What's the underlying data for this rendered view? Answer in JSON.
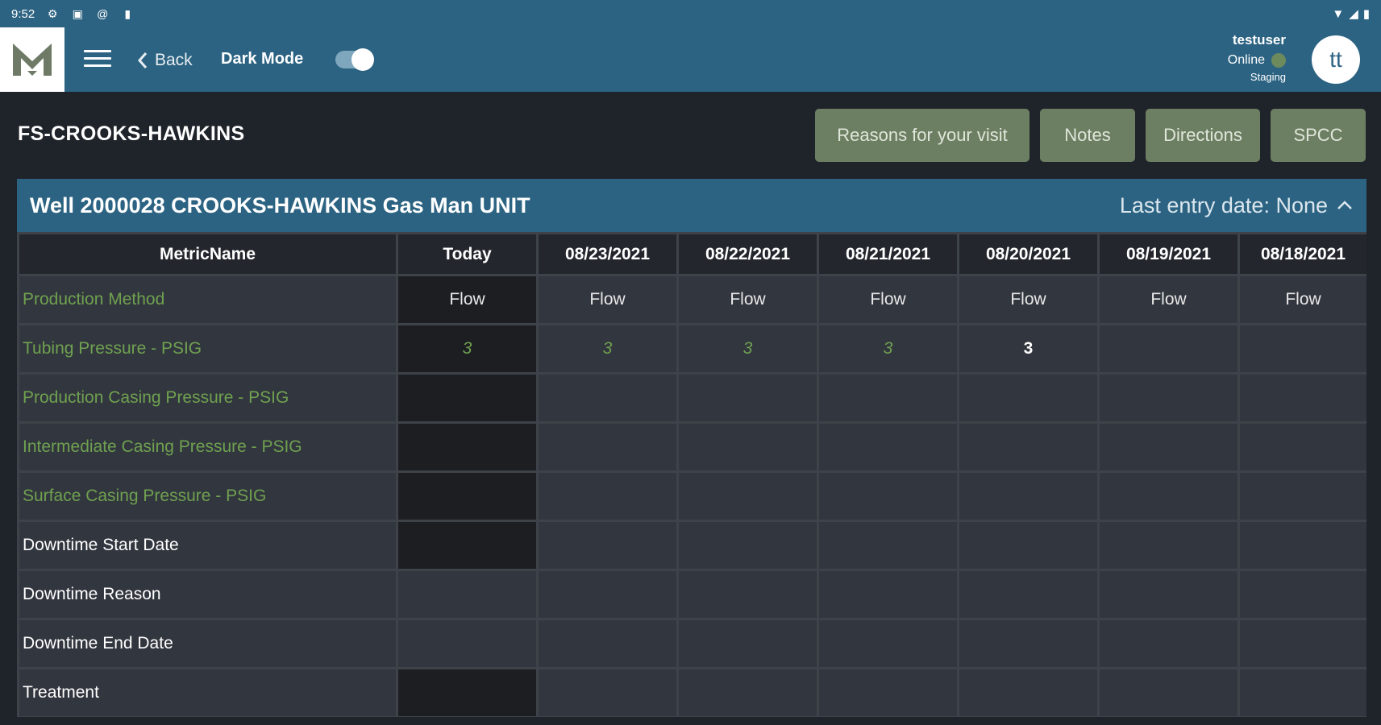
{
  "statusbar": {
    "time": "9:52",
    "left_icons": [
      "settings-icon",
      "app-icon",
      "at-icon",
      "sd-card-icon"
    ],
    "right_icons": [
      "wifi-icon",
      "signal-icon",
      "battery-icon"
    ]
  },
  "appbar": {
    "logo_letter": "M",
    "back_label": "Back",
    "dark_mode_label": "Dark Mode",
    "dark_mode_on": true,
    "user_name": "testuser",
    "user_status": "Online",
    "environment": "Staging",
    "avatar_initials": "tt"
  },
  "page": {
    "site_title": "FS-CROOKS-HAWKINS",
    "buttons": {
      "reasons": "Reasons for your visit",
      "notes": "Notes",
      "directions": "Directions",
      "spcc": "SPCC"
    }
  },
  "well": {
    "title": "Well 2000028 CROOKS-HAWKINS Gas Man UNIT",
    "last_entry": "Last entry date: None",
    "columns": [
      "MetricName",
      "Today",
      "08/23/2021",
      "08/22/2021",
      "08/21/2021",
      "08/20/2021",
      "08/19/2021",
      "08/18/2021"
    ],
    "rows": [
      {
        "name": "Production Method",
        "values": [
          "Flow",
          "Flow",
          "Flow",
          "Flow",
          "Flow",
          "Flow",
          "Flow"
        ]
      },
      {
        "name": "Tubing Pressure - PSIG",
        "values": [
          "3",
          "3",
          "3",
          "3",
          "3",
          "",
          ""
        ]
      },
      {
        "name": "Production Casing Pressure - PSIG",
        "values": [
          "",
          "",
          "",
          "",
          "",
          "",
          ""
        ]
      },
      {
        "name": "Intermediate Casing Pressure - PSIG",
        "values": [
          "",
          "",
          "",
          "",
          "",
          "",
          ""
        ]
      },
      {
        "name": "Surface Casing Pressure - PSIG",
        "values": [
          "",
          "",
          "",
          "",
          "",
          "",
          ""
        ]
      },
      {
        "name": "Downtime Start Date",
        "values": [
          "",
          "",
          "",
          "",
          "",
          "",
          ""
        ]
      },
      {
        "name": "Downtime Reason",
        "values": [
          "",
          "",
          "",
          "",
          "",
          "",
          ""
        ]
      },
      {
        "name": "Downtime End Date",
        "values": [
          "",
          "",
          "",
          "",
          "",
          "",
          ""
        ]
      },
      {
        "name": "Treatment",
        "values": [
          "",
          "",
          "",
          "",
          "",
          "",
          ""
        ]
      }
    ]
  },
  "colors": {
    "accent": "#2c6382",
    "button": "#6d7f62",
    "metric_green": "#6fa150",
    "background": "#1f232a"
  }
}
